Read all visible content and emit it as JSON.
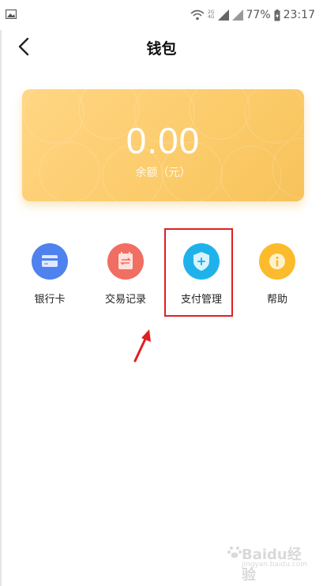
{
  "status_bar": {
    "network_top": "2G",
    "network_bottom": "4G",
    "battery": "77%",
    "time": "23:17"
  },
  "header": {
    "title": "钱包"
  },
  "balance": {
    "amount": "0.00",
    "caption": "余额（元）"
  },
  "menu": {
    "items": [
      {
        "label": "银行卡",
        "icon": "bank-card-icon",
        "color": "#4f82ee"
      },
      {
        "label": "交易记录",
        "icon": "transaction-record-icon",
        "color": "#f06e62"
      },
      {
        "label": "支付管理",
        "icon": "payment-shield-icon",
        "color": "#1fb2ea"
      },
      {
        "label": "帮助",
        "icon": "help-icon",
        "color": "#fbbb2c"
      }
    ]
  },
  "colors": {
    "card_gradient_start": "#ffd684",
    "card_gradient_end": "#f7c25a",
    "annotation": "#e02020"
  },
  "watermark": {
    "text": "Baidu经验",
    "sub": "jingyan.baidu.com"
  }
}
